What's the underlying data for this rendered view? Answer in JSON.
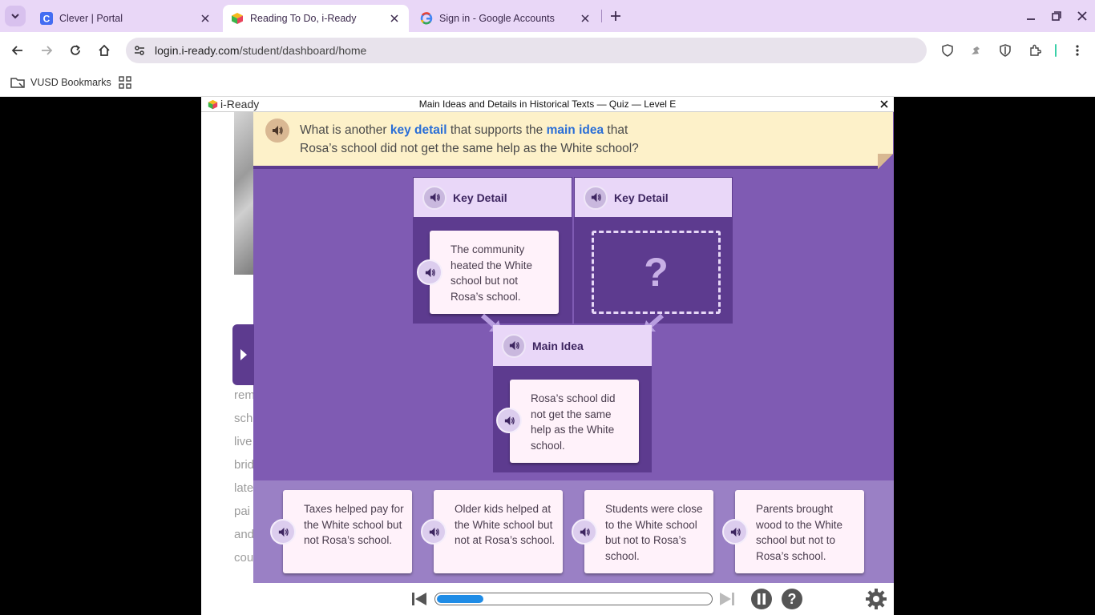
{
  "browser": {
    "tabs": [
      {
        "label": "Clever | Portal",
        "favicon": "clever-icon"
      },
      {
        "label": "Reading To Do, i-Ready",
        "favicon": "iready-icon",
        "active": true
      },
      {
        "label": "Sign in - Google Accounts",
        "favicon": "google-icon"
      }
    ],
    "url_host": "login.i-ready.com",
    "url_path": "/student/dashboard/home",
    "bookmarks": [
      {
        "label": "VUSD Bookmarks"
      }
    ]
  },
  "app": {
    "logo_text": "i-Ready",
    "title": "Main Ideas and Details in Historical Texts — Quiz — Level E",
    "question": {
      "part1": "What is another ",
      "key_detail": "key detail",
      "part2": " that supports the ",
      "main_idea": "main idea",
      "part3": " that",
      "line2": "Rosa’s school did not get the same help as the White school?"
    },
    "key_detail_1": {
      "heading": "Key Detail",
      "text": "The community heated the White school but not Rosa’s school."
    },
    "key_detail_2": {
      "heading": "Key Detail",
      "placeholder": "?"
    },
    "main_idea_box": {
      "heading": "Main Idea",
      "text": "Rosa’s school did not get the same help as the White school."
    },
    "answers": [
      {
        "text": "Taxes helped pay for the White school but not Rosa’s school."
      },
      {
        "text": "Older kids helped at the White school but not at Rosa’s school."
      },
      {
        "text": "Students were close to the White school but not to Rosa’s school."
      },
      {
        "text": "Parents brought wood to the White school but not to Rosa’s school."
      }
    ],
    "side_text_fragments": [
      "rem",
      "sch",
      "live",
      "brid",
      "late",
      "pai",
      "and",
      "cou"
    ],
    "progress_fraction": 0.17,
    "colors": {
      "accent": "#5d3b8f",
      "quiz_bg": "#7f5bb3",
      "progress": "#1f8ce6"
    }
  }
}
